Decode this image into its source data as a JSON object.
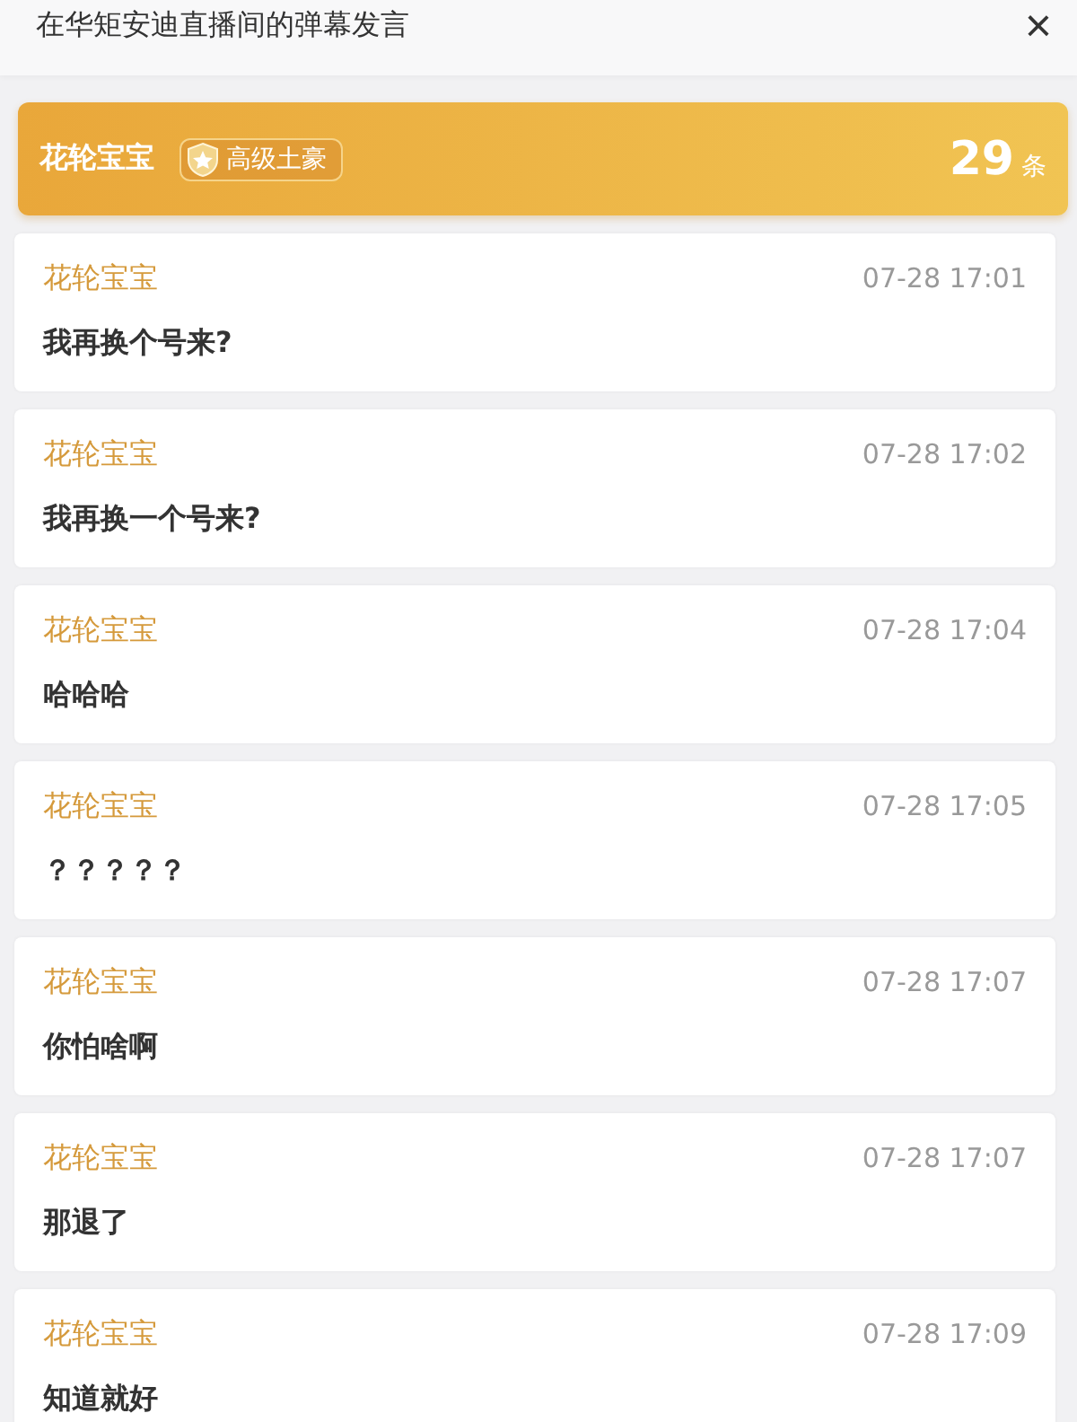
{
  "header": {
    "title": "在华矩安迪直播间的弹幕发言",
    "close": "×"
  },
  "user": {
    "name": "花轮宝宝",
    "badge": "高级土豪",
    "count": "29",
    "unit": "条"
  },
  "messages": [
    {
      "name": "花轮宝宝",
      "time": "07-28 17:01",
      "text": "我再换个号来?"
    },
    {
      "name": "花轮宝宝",
      "time": "07-28 17:02",
      "text": "我再换一个号来?"
    },
    {
      "name": "花轮宝宝",
      "time": "07-28 17:04",
      "text": "哈哈哈"
    },
    {
      "name": "花轮宝宝",
      "time": "07-28 17:05",
      "text": "？？？？？"
    },
    {
      "name": "花轮宝宝",
      "time": "07-28 17:07",
      "text": "你怕啥啊"
    },
    {
      "name": "花轮宝宝",
      "time": "07-28 17:07",
      "text": "那退了"
    },
    {
      "name": "花轮宝宝",
      "time": "07-28 17:09",
      "text": "知道就好"
    }
  ]
}
